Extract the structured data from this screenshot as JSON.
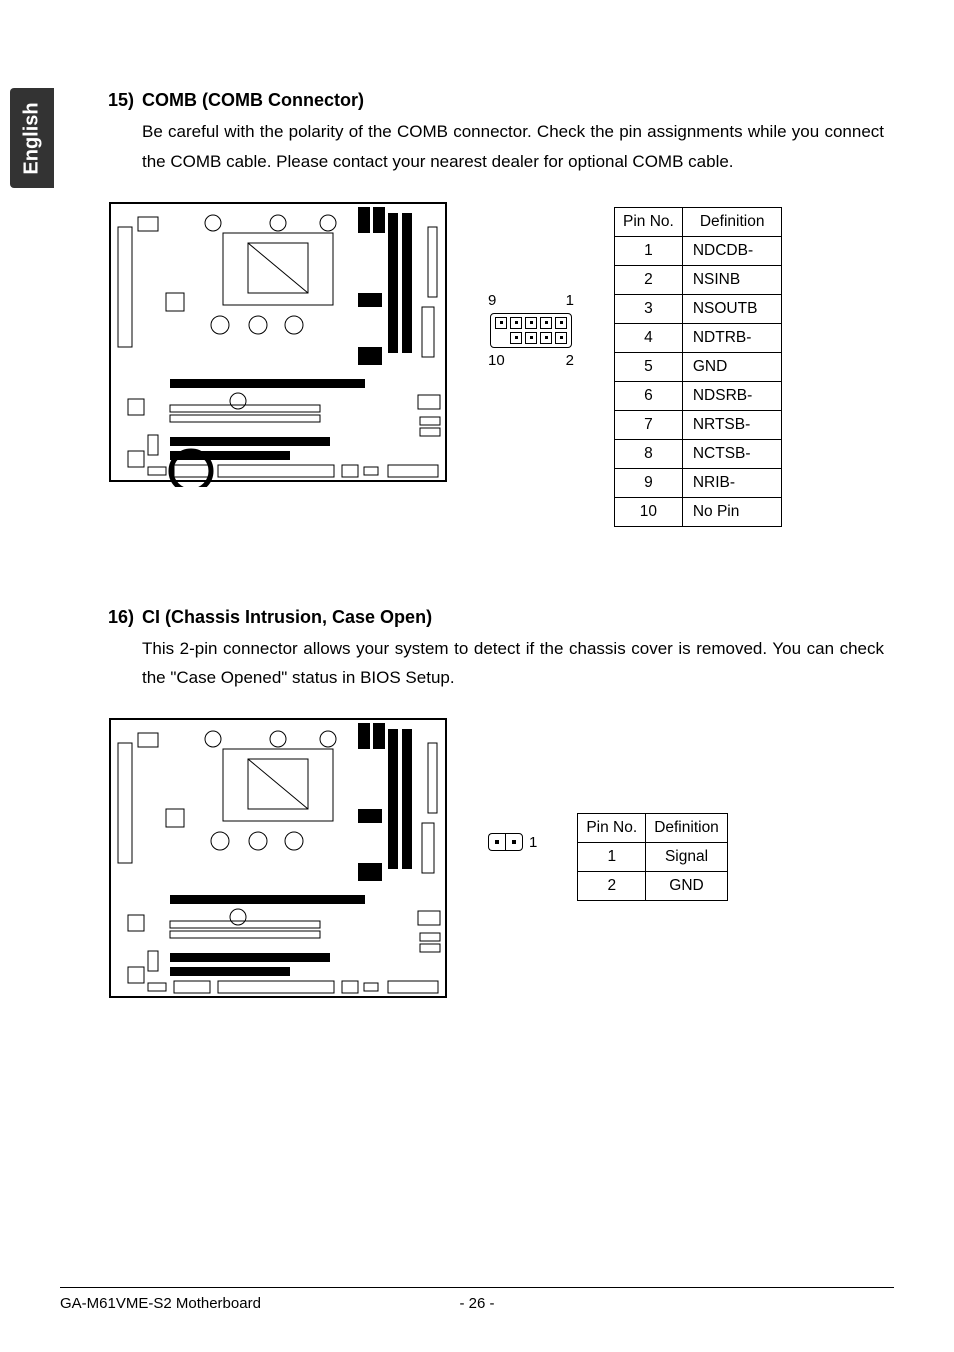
{
  "side_tab": "English",
  "section15": {
    "number": "15)",
    "title": "COMB (COMB Connector)",
    "desc": "Be careful with the polarity of the COMB connector. Check the pin assignments while you connect the COMB cable. Please contact your nearest dealer for optional COMB cable.",
    "labels": {
      "tl": "9",
      "tr": "1",
      "bl": "10",
      "br": "2"
    },
    "table": {
      "head": [
        "Pin No.",
        "Definition"
      ],
      "rows": [
        [
          "1",
          "NDCDB-"
        ],
        [
          "2",
          "NSINB"
        ],
        [
          "3",
          "NSOUTB"
        ],
        [
          "4",
          "NDTRB-"
        ],
        [
          "5",
          "GND"
        ],
        [
          "6",
          "NDSRB-"
        ],
        [
          "7",
          "NRTSB-"
        ],
        [
          "8",
          "NCTSB-"
        ],
        [
          "9",
          "NRIB-"
        ],
        [
          "10",
          "No Pin"
        ]
      ]
    }
  },
  "section16": {
    "number": "16)",
    "title": "CI (Chassis Intrusion, Case Open)",
    "desc": "This 2-pin connector allows your system to detect if the chassis cover is removed. You can check the \"Case Opened\"  status in BIOS Setup.",
    "pin_label": "1",
    "table": {
      "head": [
        "Pin No.",
        "Definition"
      ],
      "rows": [
        [
          "1",
          "Signal"
        ],
        [
          "2",
          "GND"
        ]
      ]
    }
  },
  "footer": {
    "left": "GA-M61VME-S2 Motherboard",
    "page": "- 26 -"
  }
}
